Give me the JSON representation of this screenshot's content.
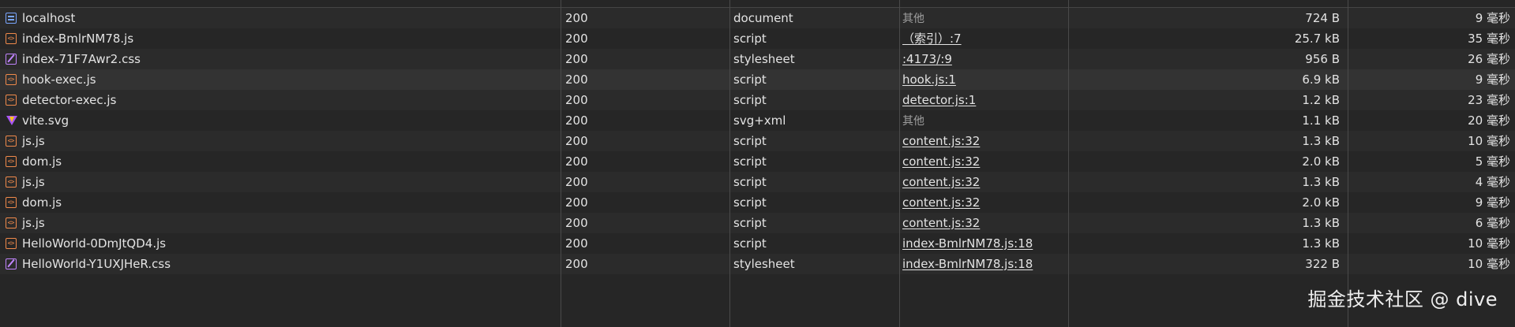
{
  "network_table": {
    "rows": [
      {
        "name": "localhost",
        "status": "200",
        "type": "document",
        "initiator": "其他",
        "initiator_kind": "muted",
        "size": "724 B",
        "time": "9 毫秒",
        "icon": "document-icon"
      },
      {
        "name": "index-BmlrNM78.js",
        "status": "200",
        "type": "script",
        "initiator": "（索引）:7",
        "initiator_kind": "link",
        "size": "25.7 kB",
        "time": "35 毫秒",
        "icon": "script-icon"
      },
      {
        "name": "index-71F7Awr2.css",
        "status": "200",
        "type": "stylesheet",
        "initiator": ":4173/:9",
        "initiator_kind": "link",
        "size": "956 B",
        "time": "26 毫秒",
        "icon": "stylesheet-icon"
      },
      {
        "name": "hook-exec.js",
        "status": "200",
        "type": "script",
        "initiator": "hook.js:1",
        "initiator_kind": "link",
        "size": "6.9 kB",
        "time": "9 毫秒",
        "icon": "script-icon"
      },
      {
        "name": "detector-exec.js",
        "status": "200",
        "type": "script",
        "initiator": "detector.js:1",
        "initiator_kind": "link",
        "size": "1.2 kB",
        "time": "23 毫秒",
        "icon": "script-icon"
      },
      {
        "name": "vite.svg",
        "status": "200",
        "type": "svg+xml",
        "initiator": "其他",
        "initiator_kind": "muted",
        "size": "1.1 kB",
        "time": "20 毫秒",
        "icon": "vite-logo-icon"
      },
      {
        "name": "js.js",
        "status": "200",
        "type": "script",
        "initiator": "content.js:32",
        "initiator_kind": "link",
        "size": "1.3 kB",
        "time": "10 毫秒",
        "icon": "script-icon"
      },
      {
        "name": "dom.js",
        "status": "200",
        "type": "script",
        "initiator": "content.js:32",
        "initiator_kind": "link",
        "size": "2.0 kB",
        "time": "5 毫秒",
        "icon": "script-icon"
      },
      {
        "name": "js.js",
        "status": "200",
        "type": "script",
        "initiator": "content.js:32",
        "initiator_kind": "link",
        "size": "1.3 kB",
        "time": "4 毫秒",
        "icon": "script-icon"
      },
      {
        "name": "dom.js",
        "status": "200",
        "type": "script",
        "initiator": "content.js:32",
        "initiator_kind": "link",
        "size": "2.0 kB",
        "time": "9 毫秒",
        "icon": "script-icon"
      },
      {
        "name": "js.js",
        "status": "200",
        "type": "script",
        "initiator": "content.js:32",
        "initiator_kind": "link",
        "size": "1.3 kB",
        "time": "6 毫秒",
        "icon": "script-icon"
      },
      {
        "name": "HelloWorld-0DmJtQD4.js",
        "status": "200",
        "type": "script",
        "initiator": "index-BmlrNM78.js:18",
        "initiator_kind": "link",
        "size": "1.3 kB",
        "time": "10 毫秒",
        "icon": "script-icon"
      },
      {
        "name": "HelloWorld-Y1UXJHeR.css",
        "status": "200",
        "type": "stylesheet",
        "initiator": "index-BmlrNM78.js:18",
        "initiator_kind": "link",
        "size": "322 B",
        "time": "10 毫秒",
        "icon": "stylesheet-icon"
      }
    ],
    "highlighted_row": 3
  },
  "watermark": "掘金技术社区 @ dive",
  "colors": {
    "background": "#262626",
    "row_alt": "#2b2b2b",
    "row_highlight": "#333333",
    "divider": "#4a4a4a",
    "text": "#e3e3e3",
    "muted": "#9e9e9e"
  }
}
